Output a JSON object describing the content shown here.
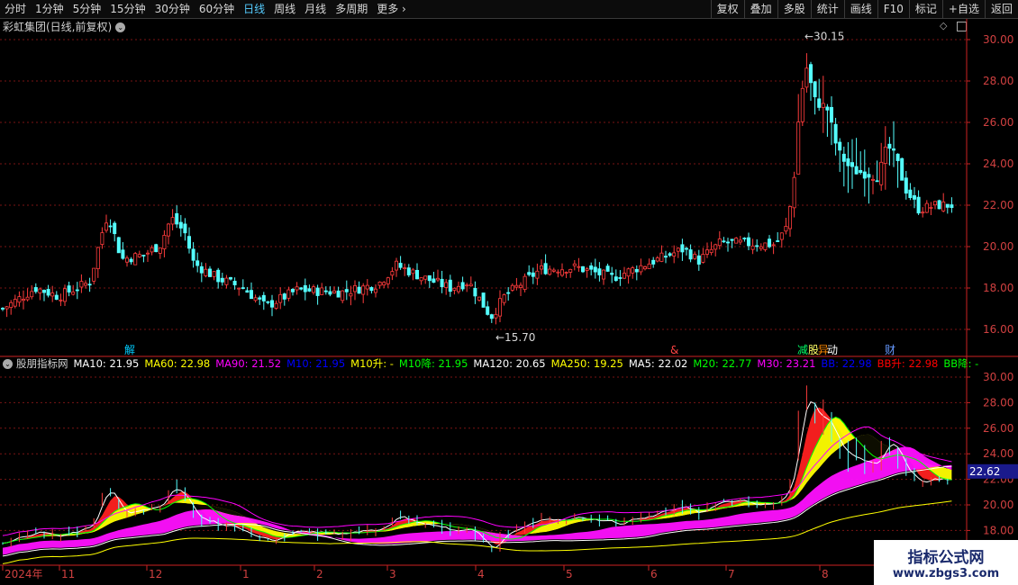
{
  "toolbar": {
    "left": [
      "分时",
      "1分钟",
      "5分钟",
      "15分钟",
      "30分钟",
      "60分钟",
      "日线",
      "周线",
      "月线",
      "多周期",
      "更多"
    ],
    "right": [
      "复权",
      "叠加",
      "多股",
      "统计",
      "画线",
      "F10",
      "标记",
      "+自选",
      "返回"
    ],
    "active": "日线"
  },
  "main_chart": {
    "title": "彩虹集团(日线,前复权)",
    "price_ticks": [
      "30.00",
      "28.00",
      "26.00",
      "24.00",
      "22.00",
      "20.00",
      "18.00",
      "16.00"
    ],
    "high_label": "30.15",
    "low_label": "15.70",
    "events": [
      "解",
      "&",
      "减",
      "股",
      "异",
      "动",
      "财"
    ]
  },
  "indicator": {
    "name": "股朋指标网",
    "items": [
      {
        "label": "MA10: 21.95",
        "color": "#ffffff"
      },
      {
        "label": "MA60: 22.98",
        "color": "#ffff00"
      },
      {
        "label": "MA90: 21.52",
        "color": "#ff00ff"
      },
      {
        "label": "M10: 21.95",
        "color": "#0000ff"
      },
      {
        "label": "M10升: -",
        "color": "#ffff00"
      },
      {
        "label": "M10降: 21.95",
        "color": "#00ff00"
      },
      {
        "label": "MA120: 20.65",
        "color": "#ffffff"
      },
      {
        "label": "MA250: 19.25",
        "color": "#ffff00"
      },
      {
        "label": "MA5: 22.02",
        "color": "#ffffff"
      },
      {
        "label": "M20: 22.77",
        "color": "#00ff00"
      },
      {
        "label": "M30: 23.21",
        "color": "#ff00ff"
      },
      {
        "label": "BB: 22.98",
        "color": "#0000ff"
      },
      {
        "label": "BB升: 22.98",
        "color": "#ff0000"
      },
      {
        "label": "BB降: -",
        "color": "#00ff00"
      }
    ],
    "price_ticks": [
      "30.00",
      "28.00",
      "26.00",
      "24.00",
      "22.00",
      "20.00",
      "18.00"
    ],
    "current_value": "22.62"
  },
  "x_axis": [
    "2024年",
    "11",
    "12",
    "1",
    "2",
    "3",
    "4",
    "5",
    "6",
    "7",
    "8"
  ],
  "watermark": {
    "title": "指标公式网",
    "url": "www.zbgs3.com"
  },
  "colors": {
    "up": "#ff3c3c",
    "down": "#54ffff",
    "grid": "#7a1414",
    "axis": "#cc2222"
  }
}
